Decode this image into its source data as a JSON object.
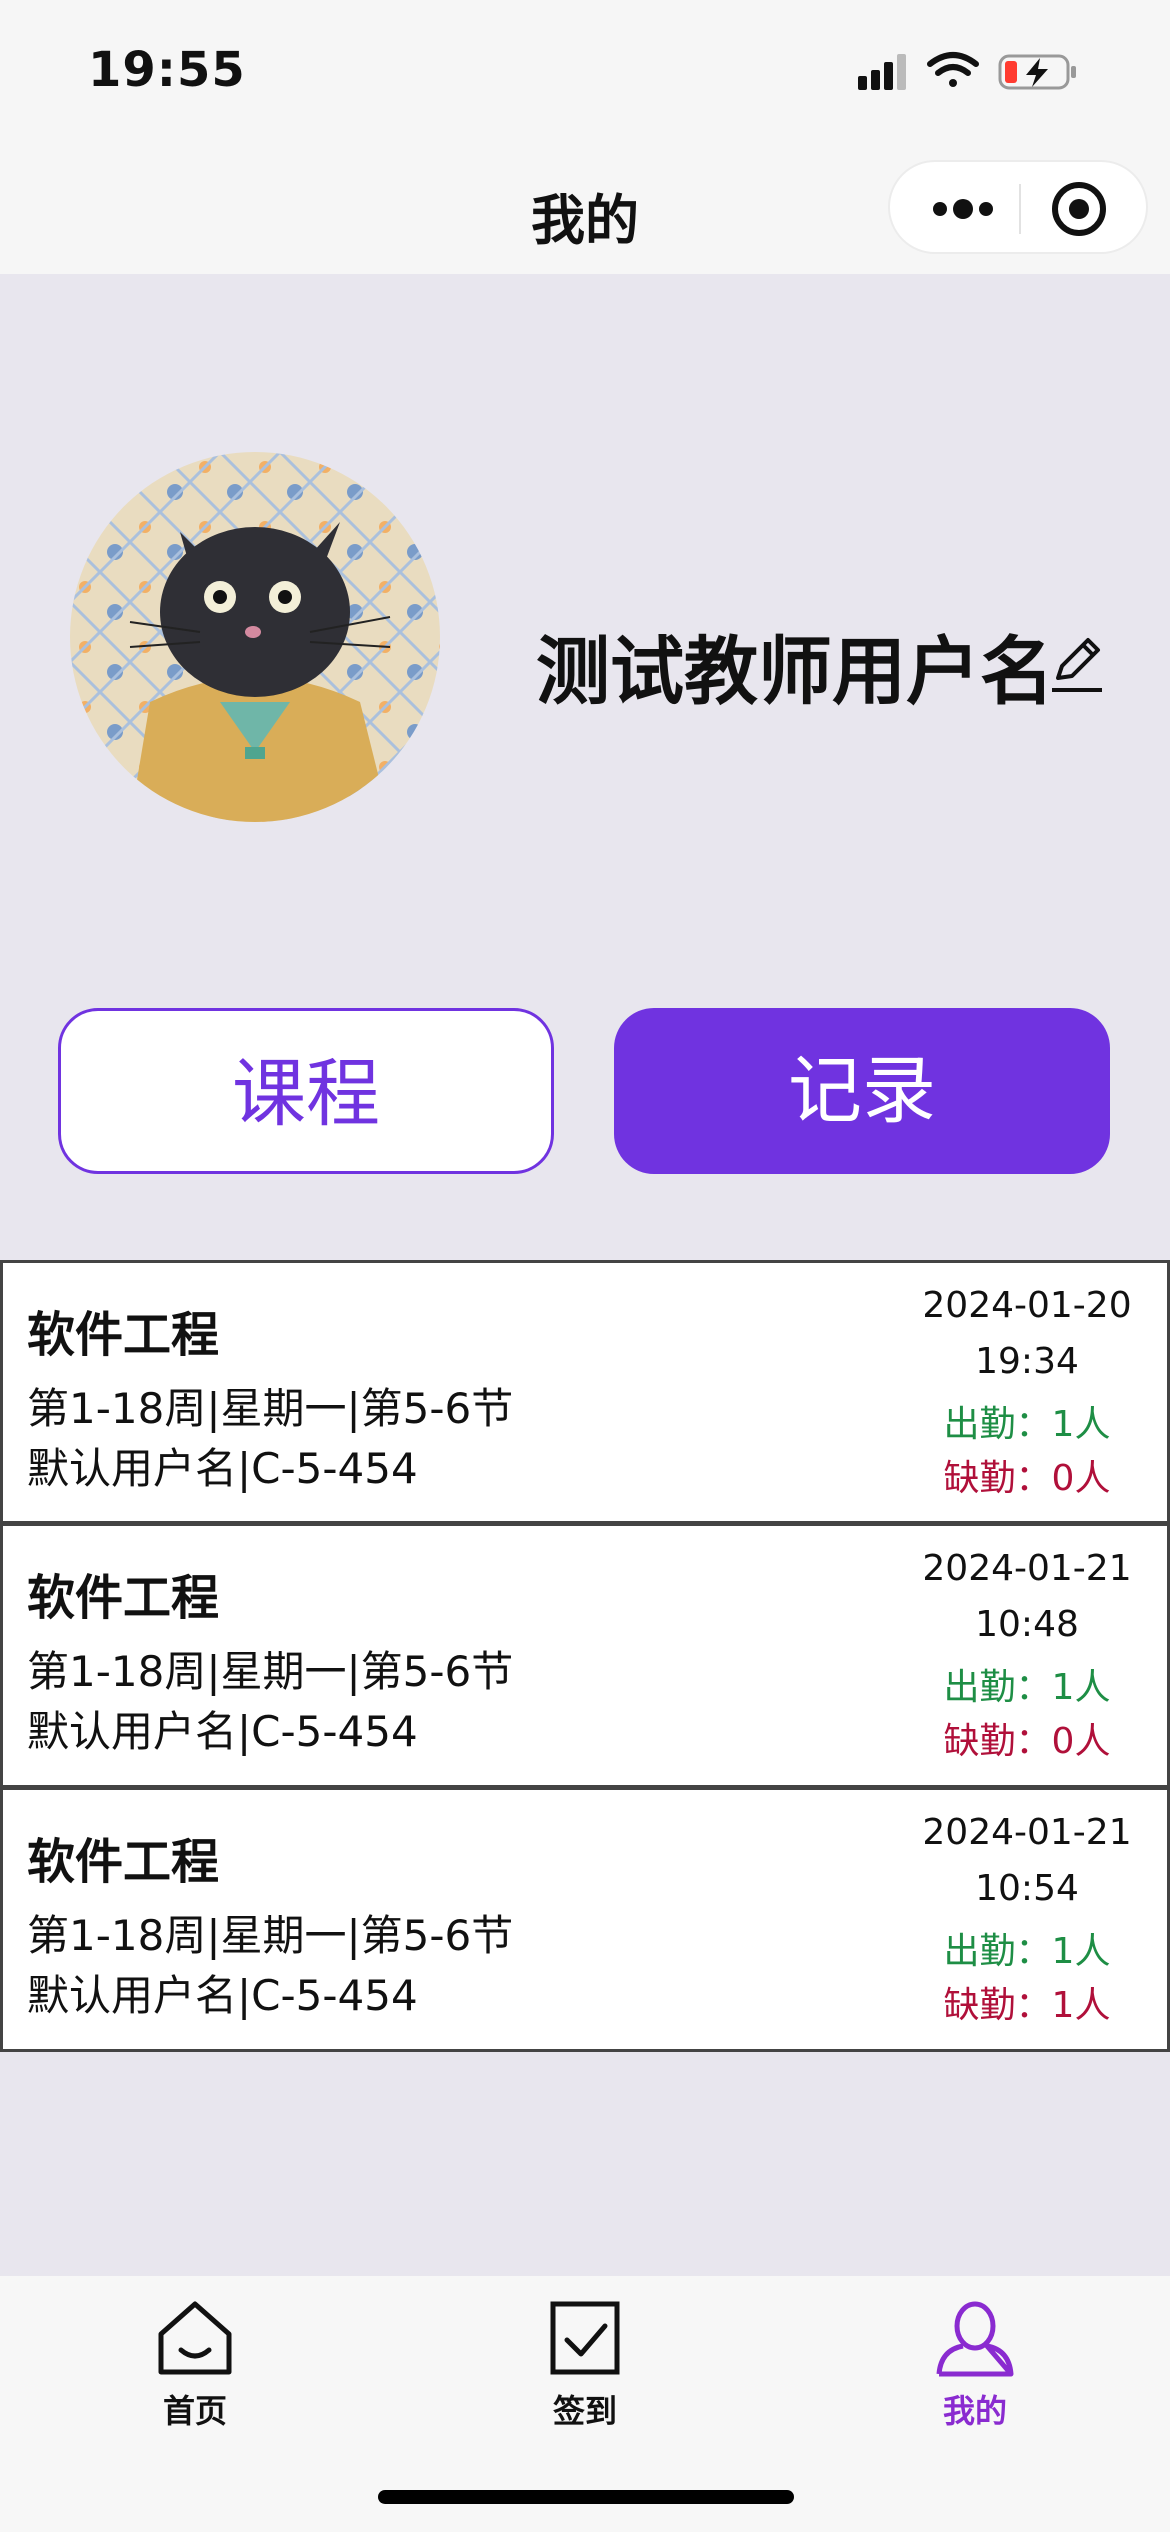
{
  "status_bar": {
    "time": "19:55",
    "icons": [
      "signal-icon",
      "wifi-icon",
      "battery-charging-icon"
    ]
  },
  "nav": {
    "title": "我的",
    "capsule": {
      "more_icon": "more-dots-icon",
      "close_icon": "target-close-icon"
    }
  },
  "profile": {
    "username": "测试教师用户名",
    "edit_icon": "pencil-icon"
  },
  "buttons": {
    "course_label": "课程",
    "record_label": "记录"
  },
  "colors": {
    "accent": "#7033e0",
    "present": "#1e8e45",
    "absent": "#b0103a",
    "page_bg": "#e8e6ee"
  },
  "records": [
    {
      "course": "软件工程",
      "schedule": "第1-18周|星期一|第5-6节",
      "location": "默认用户名|C-5-454",
      "date": "2024-01-20",
      "time": "19:34",
      "present": "出勤：1人",
      "absent": "缺勤：0人"
    },
    {
      "course": "软件工程",
      "schedule": "第1-18周|星期一|第5-6节",
      "location": "默认用户名|C-5-454",
      "date": "2024-01-21",
      "time": "10:48",
      "present": "出勤：1人",
      "absent": "缺勤：0人"
    },
    {
      "course": "软件工程",
      "schedule": "第1-18周|星期一|第5-6节",
      "location": "默认用户名|C-5-454",
      "date": "2024-01-21",
      "time": "10:54",
      "present": "出勤：1人",
      "absent": "缺勤：1人"
    }
  ],
  "tabbar": {
    "items": [
      {
        "label": "首页",
        "icon": "home-icon"
      },
      {
        "label": "签到",
        "icon": "checkin-icon"
      },
      {
        "label": "我的",
        "icon": "user-icon",
        "active": true
      }
    ]
  }
}
